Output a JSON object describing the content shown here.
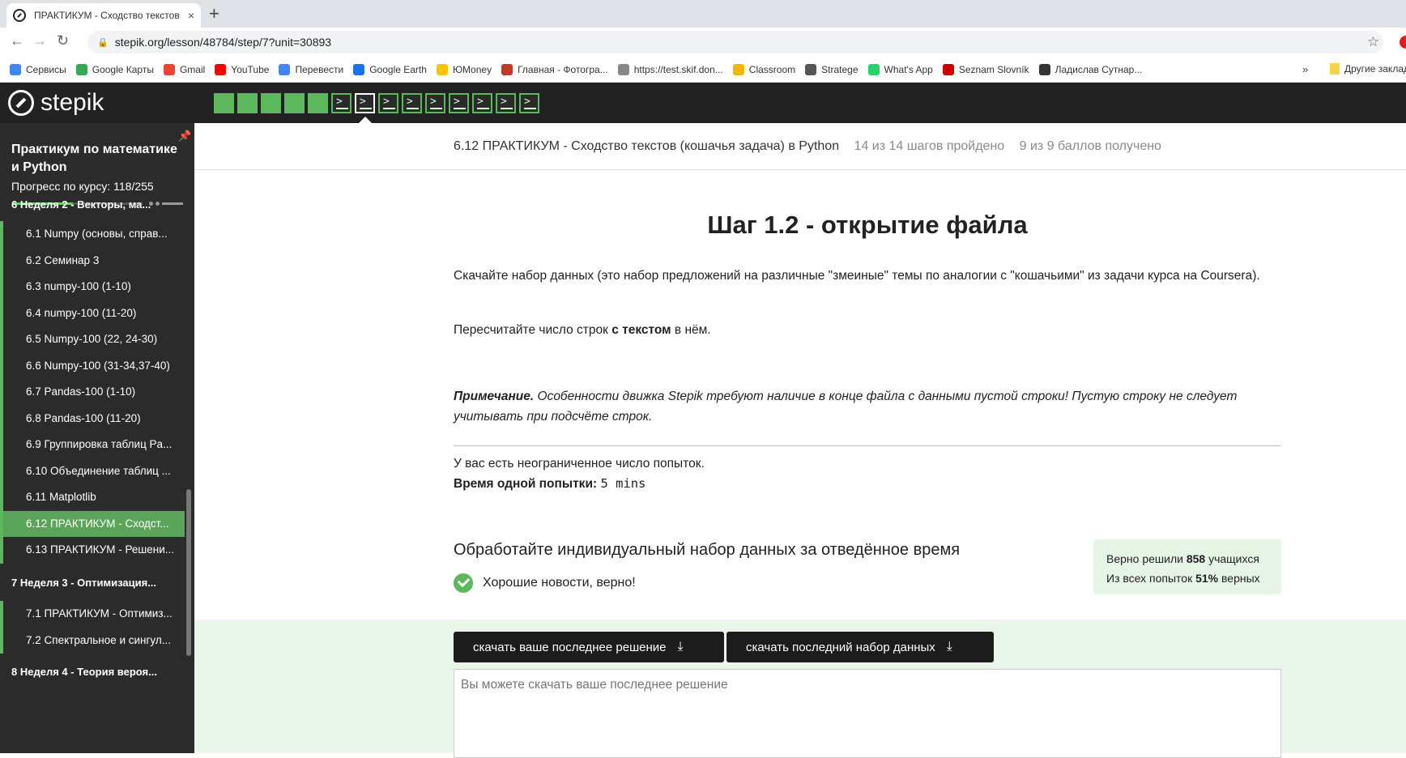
{
  "browser": {
    "tab_title": "ПРАКТИКУМ - Сходство текстов",
    "tab_close": "×",
    "new_tab": "+",
    "url": "stepik.org/lesson/48784/step/7?unit=30893",
    "bookmarks": [
      {
        "label": "Сервисы",
        "color": "#4285f4"
      },
      {
        "label": "Google Карты",
        "color": "#34a853"
      },
      {
        "label": "Gmail",
        "color": "#ea4335"
      },
      {
        "label": "YouTube",
        "color": "#ff0000"
      },
      {
        "label": "Перевести",
        "color": "#4285f4"
      },
      {
        "label": "Google Earth",
        "color": "#1a73e8"
      },
      {
        "label": "ЮMoney",
        "color": "#f9c300"
      },
      {
        "label": "Главная - Фотогра...",
        "color": "#c0392b"
      },
      {
        "label": "https://test.skif.don...",
        "color": "#888888"
      },
      {
        "label": "Classroom",
        "color": "#f4b400"
      },
      {
        "label": "Stratege",
        "color": "#555555"
      },
      {
        "label": "What's App",
        "color": "#25d366"
      },
      {
        "label": "Seznam Slovník",
        "color": "#cc0000"
      },
      {
        "label": "Ладислав Сутнар...",
        "color": "#333333"
      }
    ],
    "more": "»",
    "other_bookmarks": "Другие заклад"
  },
  "header": {
    "logo_text": "stepik",
    "steps": [
      {
        "type": "done"
      },
      {
        "type": "done"
      },
      {
        "type": "done"
      },
      {
        "type": "done"
      },
      {
        "type": "done"
      },
      {
        "type": "code"
      },
      {
        "type": "code-active"
      },
      {
        "type": "code"
      },
      {
        "type": "code"
      },
      {
        "type": "code"
      },
      {
        "type": "code"
      },
      {
        "type": "code"
      },
      {
        "type": "code"
      },
      {
        "type": "code"
      }
    ]
  },
  "sidebar": {
    "course_title": "Практикум по математике и Python",
    "progress_label": "Прогресс по курсу:  118/255",
    "progress": 0.4627,
    "section_top": "6  Неделя 2 - Векторы, ма...",
    "items": [
      {
        "label": "6.1  Numpy (основы, справ..."
      },
      {
        "label": "6.2  Семинар 3"
      },
      {
        "label": "6.3  numpy-100 (1-10)"
      },
      {
        "label": "6.4  numpy-100 (11-20)"
      },
      {
        "label": "6.5  Numpy-100 (22, 24-30)"
      },
      {
        "label": "6.6  Numpy-100 (31-34,37-40)"
      },
      {
        "label": "6.7  Pandas-100 (1-10)"
      },
      {
        "label": "6.8  Pandas-100 (11-20)"
      },
      {
        "label": "6.9  Группировка таблиц Pa..."
      },
      {
        "label": "6.10  Объединение таблиц ..."
      },
      {
        "label": "6.11  Matplotlib"
      },
      {
        "label": "6.12  ПРАКТИКУМ - Сходст..."
      },
      {
        "label": "6.13  ПРАКТИКУМ - Решени..."
      }
    ],
    "section_7": "7  Неделя 3 - Оптимизация...",
    "items_7": [
      {
        "label": "7.1  ПРАКТИКУМ - Оптимиз..."
      },
      {
        "label": "7.2  Спектральное и сингул..."
      }
    ],
    "section_8": "8  Неделя 4 - Теория вероя..."
  },
  "lesson": {
    "title": "6.12 ПРАКТИКУМ - Сходство текстов (кошачья задача) в Python",
    "steps_passed": "14 из 14 шагов пройдено",
    "points": "9 из 9 баллов  получено"
  },
  "step": {
    "title": "Шаг 1.2 - открытие файла",
    "para1": "Скачайте набор данных (это набор предложений на различные \"змеиные\" темы по аналогии с \"кошачьими\" из задачи курса на Coursera).",
    "para2_pre": "Пересчитайте число строк ",
    "para2_bold": "с текстом",
    "para2_post": " в нём.",
    "note_label": "Примечание.",
    "note_text": " Особенности движка Stepik требуют наличие в конце файла с данными пустой строки! Пустую строку не следует учитывать при подсчёте строк.",
    "attempts": "У вас есть неограниченное число попыток.",
    "time_label": "Время одной попытки:",
    "time_value": "5 mins"
  },
  "task": {
    "title": "Обработайте индивидуальный набор данных за отведённое время",
    "success": "Хорошие новости, верно!",
    "stats_line1_pre": "Верно решили ",
    "stats_solved": "858",
    "stats_line1_post": " учащихся",
    "stats_line2_pre": "Из всех попыток ",
    "stats_percent": "51%",
    "stats_line2_post": " верных",
    "btn_download_solution": "скачать ваше последнее решение",
    "btn_download_dataset": "скачать последний набор данных",
    "download_icon": "⤓",
    "answer_placeholder": "Вы можете скачать ваше последнее решение"
  },
  "colors": {
    "accent": "#5cb85c",
    "header_bg": "#222222",
    "sidebar_bg": "#2b2b2b",
    "active_item": "#5ba55b"
  }
}
